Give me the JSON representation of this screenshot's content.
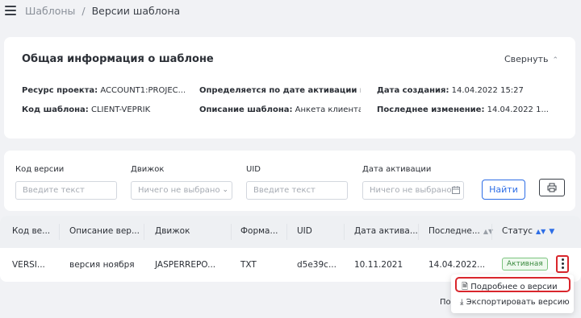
{
  "breadcrumb": {
    "parent": "Шаблоны",
    "separator": "/",
    "current": "Версии шаблона"
  },
  "info": {
    "title": "Общая информация о шаблоне",
    "collapse_label": "Свернуть",
    "fields": {
      "resource_label": "Ресурс проекта:",
      "resource_value": "ACCOUNT1:PROJEC...",
      "activation_label": "Определяется по дате активации вер...",
      "activation_value": "",
      "created_label": "Дата создания:",
      "created_value": "14.04.2022 15:27",
      "code_label": "Код шаблона:",
      "code_value": "CLIENT-VEPRIK",
      "desc_label": "Описание шаблона:",
      "desc_value": "Анкета клиента",
      "modified_label": "Последнее изменение:",
      "modified_value": "14.04.2022 1..."
    }
  },
  "filters": {
    "version_code": {
      "label": "Код версии",
      "placeholder": "Введите текст"
    },
    "engine": {
      "label": "Движок",
      "placeholder": "Ничего не выбрано"
    },
    "uid": {
      "label": "UID",
      "placeholder": "Введите текст"
    },
    "activation_date": {
      "label": "Дата активации",
      "placeholder": "Ничего не выбрано"
    },
    "find_label": "Найти"
  },
  "table": {
    "headers": [
      "Код ве...",
      "Описание вер...",
      "Движок",
      "Форма...",
      "UID",
      "Дата актива...",
      "Последне...",
      "Статус"
    ],
    "row": [
      "VERSI...",
      "версия ноября",
      "JASPERREPO...",
      "TXT",
      "d5e39c...",
      "10.11.2021",
      "14.04.2022...",
      "Активная"
    ]
  },
  "menu": {
    "details": "Подробнее о версии",
    "export": "Экспортировать версию"
  },
  "pagination_fragment": "По"
}
